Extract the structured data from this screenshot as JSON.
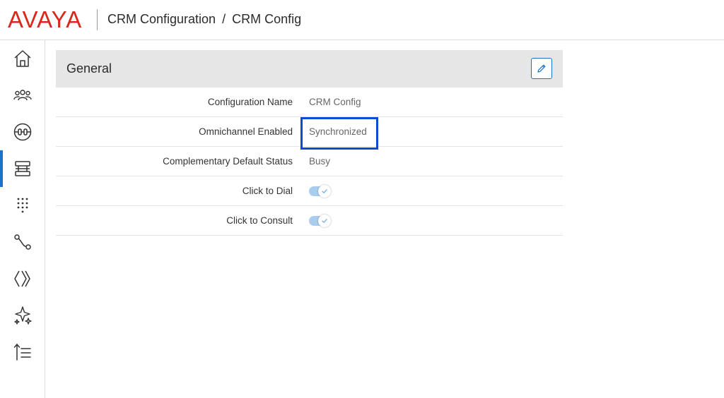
{
  "header": {
    "logo_text": "AVAYA",
    "breadcrumb": {
      "parent": "CRM Configuration",
      "separator": "/",
      "current": "CRM Config"
    }
  },
  "sidebar": {
    "items": [
      {
        "name": "home-icon",
        "active": false
      },
      {
        "name": "users-icon",
        "active": false
      },
      {
        "name": "channels-icon",
        "active": false
      },
      {
        "name": "configuration-icon",
        "active": true
      },
      {
        "name": "dialpad-icon",
        "active": false
      },
      {
        "name": "routing-icon",
        "active": false
      },
      {
        "name": "integrations-icon",
        "active": false
      },
      {
        "name": "ai-sparkle-icon",
        "active": false
      },
      {
        "name": "priority-list-icon",
        "active": false
      }
    ]
  },
  "card": {
    "title": "General",
    "edit_icon": "pencil-icon",
    "rows": [
      {
        "label": "Configuration Name",
        "value": "CRM Config"
      },
      {
        "label": "Omnichannel Enabled",
        "value": "Synchronized"
      },
      {
        "label": "Complementary Default Status",
        "value": "Busy"
      },
      {
        "label": "Click to Dial",
        "toggle": true
      },
      {
        "label": "Click to Consult",
        "toggle": true
      }
    ]
  },
  "colors": {
    "brand_red": "#da291c",
    "accent_blue": "#1a73c8",
    "highlight_blue": "#0b4ccf",
    "toggle_track": "#a9cdee"
  }
}
